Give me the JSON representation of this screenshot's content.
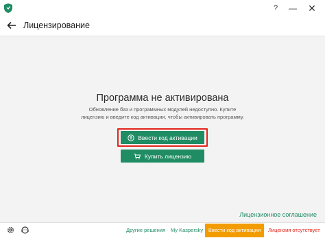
{
  "window": {
    "help_glyph": "?",
    "minimize_glyph": "—",
    "close_glyph": "✕"
  },
  "header": {
    "title": "Лицензирование"
  },
  "main": {
    "heading": "Программа не активирована",
    "description_line1": "Обновление баз и программных модулей недоступно. Купите",
    "description_line2": "лицензию и введите код активации, чтобы активировать программу.",
    "activate_button_label": "Ввести код активации",
    "buy_button_label": "Купить лицензию",
    "license_agreement_link": "Лицензионное соглашение"
  },
  "footer": {
    "other_solutions": "Другие решения",
    "my_kaspersky": "My Kaspersky",
    "activate_button": "Ввести код активации",
    "license_status": "Лицензия отсутствует"
  },
  "colors": {
    "accent_green": "#1f8c64",
    "highlight_red": "#e2241b",
    "footer_orange": "#f29c00"
  }
}
